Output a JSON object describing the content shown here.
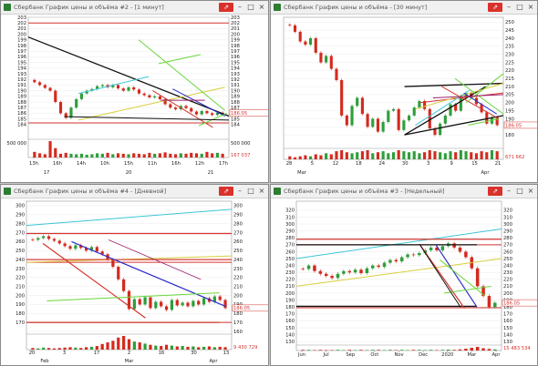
{
  "colors": {
    "bull": "#2e9e3a",
    "bear": "#d42a1e",
    "black": "#111111",
    "red": "#d2352f",
    "cyan": "#3cc6d6",
    "green": "#6ad63a",
    "yellow": "#d8cf3c",
    "blue": "#2d2dc8",
    "magenta": "#9b1f6b",
    "vol_up": "#2e9e3a",
    "vol_down": "#d42a1e"
  },
  "icons": {
    "pin": "pin-icon",
    "minimize": "minimize-icon",
    "maximize": "maximize-icon",
    "close": "close-icon"
  },
  "windows": [
    {
      "id": "w1",
      "title": "Сбербанк График цены и объёма #2 - [1 минут]",
      "pin_label": "⇗",
      "chart_data": {
        "type": "candlestick",
        "ylim": [
          183,
          203
        ],
        "left_ticks": [
          "203",
          "202",
          "201",
          "200",
          "199",
          "198",
          "197",
          "196",
          "195",
          "194",
          "193",
          "192",
          "191",
          "190",
          "189",
          "188",
          "187",
          "186",
          "185",
          "184"
        ],
        "right_ticks": [
          "203",
          "202",
          "201",
          "200",
          "199",
          "198",
          "197",
          "196",
          "195",
          "194",
          "193",
          "192",
          "191",
          "190",
          "189",
          "188",
          "187",
          "186",
          "185",
          "184"
        ],
        "left_tick_vals": [
          203,
          202,
          201,
          200,
          199,
          198,
          197,
          196,
          195,
          194,
          193,
          192,
          191,
          190,
          189,
          188,
          187,
          186,
          185,
          184
        ],
        "last_price": "186.05",
        "last_price_value": 186.05,
        "volume_left_label": "500 000",
        "volume_right_labels": [
          "500 000"
        ],
        "last_volume": "167 037",
        "x_time_labels": [
          "13h",
          "16h",
          "14h",
          "10h",
          "15h",
          "11h",
          "16h",
          "12h",
          "17h"
        ],
        "x_date_labels": [
          "17",
          "20",
          "21"
        ],
        "hlines": [
          202,
          184.3
        ],
        "close": [
          191.5,
          191,
          190.5,
          190,
          188,
          186,
          185.2,
          187,
          188.5,
          189.5,
          190,
          190.3,
          190.8,
          191,
          190.6,
          191,
          190.4,
          190,
          190.6,
          190.2,
          189.5,
          189.2,
          188.8,
          189,
          188.5,
          187.6,
          187,
          186.7,
          187.3,
          186.9,
          186.3,
          185.8,
          186.4,
          186,
          185.7,
          186.1,
          186.05
        ],
        "volume": [
          12,
          9,
          7,
          35,
          20,
          8,
          10,
          8,
          7,
          8,
          6,
          7,
          9,
          8,
          10,
          7,
          9,
          8,
          7,
          9,
          8,
          7,
          10,
          8,
          9,
          11,
          8,
          7,
          9,
          8,
          10,
          9,
          8,
          12,
          9,
          10,
          8
        ]
      }
    },
    {
      "id": "w2",
      "title": "Сбербанк График цены и объёма - [30 минут]",
      "pin_label": "⇗",
      "chart_data": {
        "type": "candlestick",
        "ylim": [
          175,
          253
        ],
        "right_ticks": [
          "250",
          "245",
          "240",
          "235",
          "230",
          "225",
          "220",
          "215",
          "210",
          "205",
          "200",
          "195",
          "190",
          "185",
          "180"
        ],
        "right_tick_vals": [
          250,
          245,
          240,
          235,
          230,
          225,
          220,
          215,
          210,
          205,
          200,
          195,
          190,
          185,
          180
        ],
        "last_price": "186.05",
        "last_price_value": 186.05,
        "last_volume": "671 662",
        "x_date_labels": [
          "28",
          "5",
          "12",
          "18",
          "24",
          "30",
          "3",
          "9",
          "15",
          "21"
        ],
        "x_month_labels": [
          "Mar",
          "Apr"
        ],
        "close": [
          248,
          244,
          238,
          236,
          240,
          231,
          225,
          229,
          221,
          214,
          192,
          186,
          198,
          203,
          193,
          185,
          190,
          182,
          188,
          195,
          196,
          183,
          189,
          192,
          197,
          201,
          196,
          184,
          180,
          187,
          192,
          199,
          195,
          204,
          206,
          203,
          199,
          194,
          187,
          191,
          186.05
        ],
        "volume": [
          3,
          2,
          3,
          4,
          3,
          5,
          4,
          6,
          5,
          8,
          9,
          7,
          6,
          7,
          8,
          9,
          6,
          7,
          8,
          6,
          7,
          9,
          8,
          7,
          8,
          6,
          7,
          9,
          8,
          7,
          6,
          8,
          7,
          9,
          8,
          7,
          6,
          8,
          7,
          9,
          8
        ]
      }
    },
    {
      "id": "w3",
      "title": "Сбербанк График цены и объёма #4 - [Дневной]",
      "pin_label": "⇗",
      "chart_data": {
        "type": "candlestick",
        "ylim": [
          157,
          305
        ],
        "left_ticks": [
          "300",
          "290",
          "280",
          "270",
          "260",
          "250",
          "240",
          "230",
          "220",
          "210",
          "200",
          "190",
          "180",
          "170"
        ],
        "left_tick_vals": [
          300,
          290,
          280,
          270,
          260,
          250,
          240,
          230,
          220,
          210,
          200,
          190,
          180,
          170
        ],
        "right_ticks": [
          "300",
          "290",
          "280",
          "270",
          "260",
          "250",
          "240",
          "230",
          "220",
          "210",
          "200",
          "190",
          "180",
          "170",
          "160"
        ],
        "right_tick_vals": [
          300,
          290,
          280,
          270,
          260,
          250,
          240,
          230,
          220,
          210,
          200,
          190,
          180,
          170,
          160
        ],
        "last_price": "186.05",
        "last_price_value": 186.05,
        "last_volume": "9 430 729",
        "x_date_labels": [
          "20",
          "3",
          "17",
          "2",
          "16",
          "30",
          "13"
        ],
        "x_month_labels": [
          "Feb",
          "Mar",
          "Apr"
        ],
        "hlines": [
          269,
          240,
          237,
          170
        ],
        "close": [
          262,
          264,
          266,
          263,
          261,
          258,
          255,
          252,
          256,
          253,
          250,
          254,
          249,
          246,
          240,
          232,
          218,
          205,
          185,
          196,
          190,
          198,
          186,
          193,
          188,
          184,
          195,
          189,
          192,
          188,
          194,
          190,
          197,
          193,
          199,
          195,
          186.05
        ],
        "volume": [
          4,
          3,
          5,
          4,
          3,
          4,
          5,
          6,
          5,
          4,
          6,
          7,
          9,
          14,
          18,
          22,
          30,
          34,
          26,
          20,
          18,
          15,
          12,
          10,
          9,
          12,
          10,
          8,
          9,
          7,
          8,
          6,
          7,
          8,
          6,
          7,
          6
        ]
      }
    },
    {
      "id": "w4",
      "title": "Сбербанк График цены и объёма #3 - [Недельный]",
      "pin_label": "⇗",
      "chart_data": {
        "type": "candlestick",
        "ylim": [
          125,
          333
        ],
        "right_ticks": [
          "320",
          "310",
          "300",
          "290",
          "280",
          "270",
          "260",
          "250",
          "240",
          "230",
          "220",
          "210",
          "200",
          "190",
          "180",
          "170",
          "160",
          "150",
          "140",
          "130"
        ],
        "right_tick_vals": [
          320,
          310,
          300,
          290,
          280,
          270,
          260,
          250,
          240,
          230,
          220,
          210,
          200,
          190,
          180,
          170,
          160,
          150,
          140,
          130
        ],
        "left_ticks": [
          "320",
          "310",
          "300",
          "290",
          "280",
          "270",
          "260",
          "250",
          "240",
          "230",
          "220",
          "210",
          "200",
          "190",
          "180",
          "170",
          "160",
          "150",
          "140",
          "130"
        ],
        "left_tick_vals": [
          320,
          310,
          300,
          290,
          280,
          270,
          260,
          250,
          240,
          230,
          220,
          210,
          200,
          190,
          180,
          170,
          160,
          150,
          140,
          130
        ],
        "last_price": "186.05",
        "last_price_value": 186.05,
        "last_volume": "15 483 534",
        "x_month_labels": [
          "Jun",
          "Jul",
          "Sep",
          "Oct",
          "Nov",
          "Dec",
          "2020",
          "Mar",
          "Apr"
        ],
        "hlines": [
          270,
          179
        ],
        "close": [
          235,
          240,
          232,
          228,
          225,
          222,
          228,
          232,
          230,
          234,
          229,
          236,
          240,
          238,
          244,
          248,
          246,
          252,
          256,
          255,
          258,
          262,
          266,
          262,
          268,
          272,
          266,
          260,
          252,
          236,
          210,
          196,
          180,
          186.05
        ],
        "volume": [
          3,
          3,
          2,
          3,
          2,
          2,
          3,
          2,
          3,
          2,
          3,
          2,
          3,
          3,
          2,
          3,
          2,
          3,
          2,
          3,
          3,
          2,
          3,
          2,
          3,
          4,
          3,
          5,
          8,
          12,
          16,
          10,
          7,
          5
        ]
      }
    }
  ]
}
